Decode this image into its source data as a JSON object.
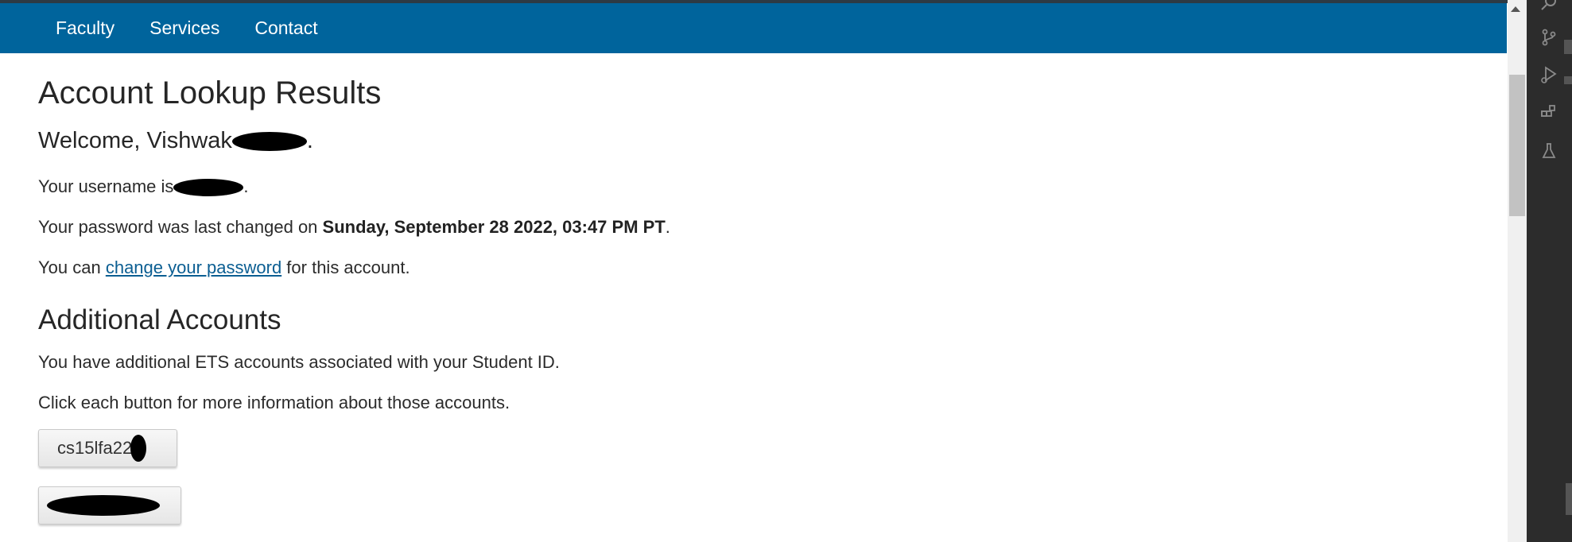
{
  "nav": {
    "items": [
      {
        "label": "Faculty"
      },
      {
        "label": "Services"
      },
      {
        "label": "Contact"
      }
    ]
  },
  "page": {
    "title": "Account Lookup Results",
    "welcome_prefix": "Welcome, Vishwak",
    "welcome_suffix": ".",
    "username_prefix": "Your username is",
    "username_suffix": ".",
    "password_changed_prefix": "Your password was last changed on ",
    "password_changed_date": "Sunday, September 28 2022, 03:47 PM PT",
    "password_changed_suffix": ".",
    "change_prefix": "You can ",
    "change_link": "change your password",
    "change_suffix": " for this account."
  },
  "additional": {
    "title": "Additional Accounts",
    "line1": "You have additional ETS accounts associated with your Student ID.",
    "line2": "Click each button for more information about those accounts.",
    "accounts": [
      {
        "label": "cs15lfa22"
      },
      {
        "label": ""
      }
    ]
  },
  "activity_bar": {
    "icons": [
      "search-icon",
      "source-control-icon",
      "run-debug-icon",
      "extensions-icon",
      "testing-icon"
    ]
  },
  "colors": {
    "navbar": "#00649c",
    "link": "#0b5e92",
    "activity_bar": "#2c2c2c"
  }
}
